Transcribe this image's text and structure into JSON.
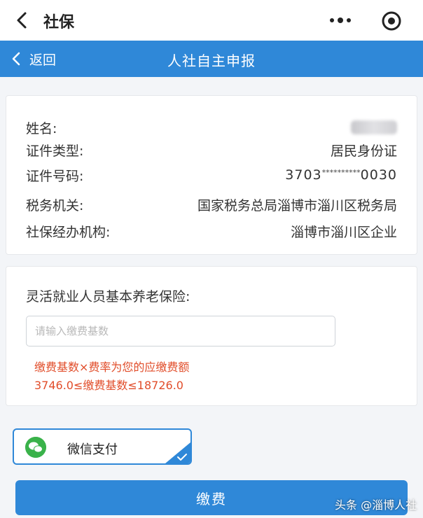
{
  "topbar": {
    "title": "社保"
  },
  "header": {
    "back_label": "返回",
    "title": "人社自主申报"
  },
  "info": [
    {
      "label": "姓名:",
      "value": ""
    },
    {
      "label": "证件类型:",
      "value": "居民身份证"
    },
    {
      "label": "证件号码:",
      "value_prefix": "3703",
      "value_mask": "**********",
      "value_suffix": "0030"
    },
    {
      "label": "税务机关:",
      "value": "国家税务总局淄博市淄川区税务局"
    },
    {
      "label": "社保经办机构:",
      "value": "淄博市淄川区企业"
    }
  ],
  "insurance": {
    "label": "灵活就业人员基本养老保险:",
    "placeholder": "请输入缴费基数",
    "hint1": "缴费基数×费率为您的应缴费额",
    "hint2": "3746.0≤缴费基数≤18726.0"
  },
  "payment": {
    "method_label": "微信支付"
  },
  "submit": {
    "label": "缴费"
  },
  "watermark": "头条 @淄博人社",
  "colors": {
    "accent": "#2f88d8",
    "hint": "#e14d2a",
    "wechat": "#3ab24a"
  }
}
